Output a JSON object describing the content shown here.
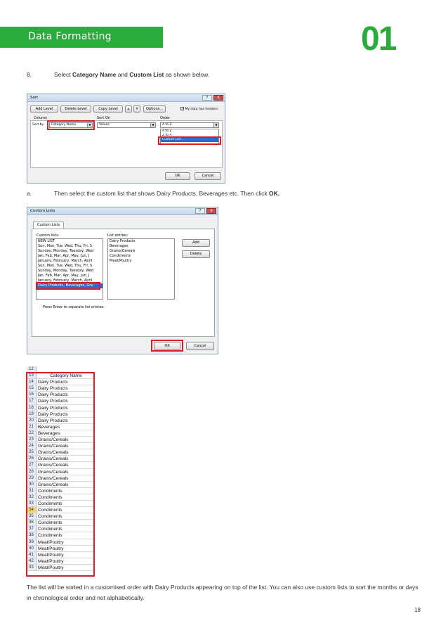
{
  "header": {
    "title": "Data Formatting",
    "chapter": "01"
  },
  "step8": {
    "num": "8.",
    "pre": "Select ",
    "b1": "Category Name",
    "mid": " and ",
    "b2": "Custom List",
    "post": " as shown below."
  },
  "sort_dialog": {
    "title": "Sort",
    "help": "?",
    "close": "X",
    "toolbar": {
      "add": "Add Level",
      "delete": "Delete Level",
      "copy": "Copy Level",
      "up": "▲",
      "down": "▼",
      "options": "Options...",
      "headers": "My data has headers"
    },
    "columns": {
      "column": "Column",
      "sort_on": "Sort On",
      "order": "Order"
    },
    "row": {
      "label": "Sort by",
      "column": "Category Name",
      "sort_on": "Values",
      "order": "A to Z"
    },
    "order_options": [
      "A to Z",
      "Z to A",
      "Custom List..."
    ],
    "ok": "OK",
    "cancel": "Cancel"
  },
  "stepa": {
    "num": "a.",
    "pre": "Then select the custom list that shows Dairy Products, Beverages etc. Then click ",
    "b": "OK."
  },
  "custom_dialog": {
    "title": "Custom Lists",
    "help": "?",
    "close": "X",
    "tab": "Custom Lists",
    "lists_label": "Custom lists:",
    "entries_label": "List entries:",
    "lists": [
      "NEW LIST",
      "Sun, Mon, Tue, Wed, Thu, Fri, S",
      "Sunday, Monday, Tuesday, Wed",
      "Jan, Feb, Mar, Apr, May, Jun, J",
      "January, February, March, April",
      "Sun, Mon, Tue, Wed, Thu, Fri, S",
      "Sunday, Monday, Tuesday, Wed",
      "Jan, Feb, Mar, Apr, May, Jun, J",
      "January, February, March, April",
      "Dairy Products, Beverages, Gra"
    ],
    "entries": [
      "Dairy Products",
      "Beverages",
      "Grains/Cereals",
      "Condiments",
      "Meat/Poultry"
    ],
    "add": "Add",
    "delete": "Delete",
    "hint": "Press Enter to separate list entries.",
    "ok": "OK",
    "cancel": "Cancel"
  },
  "sheet": {
    "header_row": "12",
    "col_header_row": "13",
    "col_header": "Category Name",
    "active_row": "34",
    "rows": [
      {
        "n": "14",
        "v": "Dairy Products"
      },
      {
        "n": "15",
        "v": "Dairy Products"
      },
      {
        "n": "16",
        "v": "Dairy Products"
      },
      {
        "n": "17",
        "v": "Dairy Products"
      },
      {
        "n": "18",
        "v": "Dairy Products"
      },
      {
        "n": "19",
        "v": "Dairy Products"
      },
      {
        "n": "20",
        "v": "Dairy Products"
      },
      {
        "n": "21",
        "v": "Beverages"
      },
      {
        "n": "22",
        "v": "Beverages"
      },
      {
        "n": "23",
        "v": "Grains/Cereals"
      },
      {
        "n": "24",
        "v": "Grains/Cereals"
      },
      {
        "n": "25",
        "v": "Grains/Cereals"
      },
      {
        "n": "26",
        "v": "Grains/Cereals"
      },
      {
        "n": "27",
        "v": "Grains/Cereals"
      },
      {
        "n": "28",
        "v": "Grains/Cereals"
      },
      {
        "n": "29",
        "v": "Grains/Cereals"
      },
      {
        "n": "30",
        "v": "Grains/Cereals"
      },
      {
        "n": "31",
        "v": "Condiments"
      },
      {
        "n": "32",
        "v": "Condiments"
      },
      {
        "n": "33",
        "v": "Condiments"
      },
      {
        "n": "34",
        "v": "Condiments"
      },
      {
        "n": "35",
        "v": "Condiments"
      },
      {
        "n": "36",
        "v": "Condiments"
      },
      {
        "n": "37",
        "v": "Condiments"
      },
      {
        "n": "38",
        "v": "Condiments"
      },
      {
        "n": "39",
        "v": "Meat/Poultry"
      },
      {
        "n": "40",
        "v": "Meat/Poultry"
      },
      {
        "n": "41",
        "v": "Meat/Poultry"
      },
      {
        "n": "42",
        "v": "Meat/Poultry"
      },
      {
        "n": "43",
        "v": "Meat/Poultry"
      }
    ]
  },
  "footer": {
    "paragraph": "The list will be sorted in a customised order with Dairy Products appearing on top of the list. You can also use custom lists to sort the months or days in chronological order and not alphabetically.",
    "page": "18"
  }
}
